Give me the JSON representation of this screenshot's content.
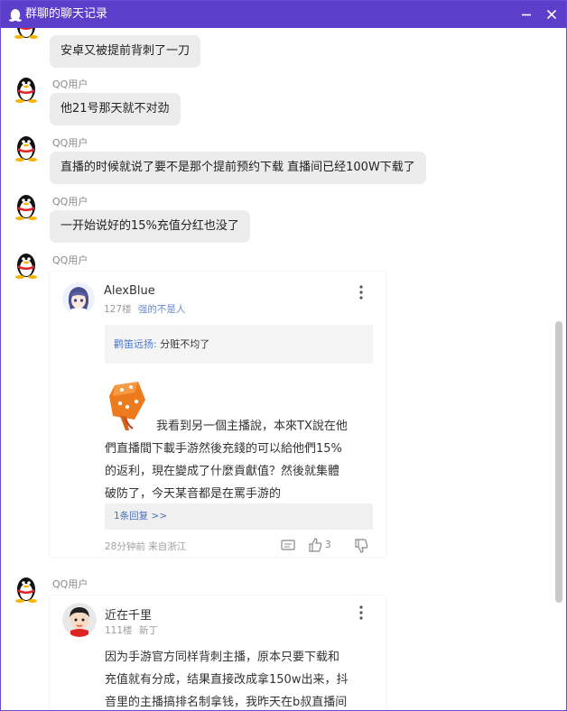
{
  "window": {
    "title": "群聊的聊天记录",
    "accent": "#5b3ec9"
  },
  "messages": [
    {
      "sender": "",
      "text": "安卓又被提前背刺了一刀"
    },
    {
      "sender": "QQ用户",
      "text": "他21号那天就不对劲"
    },
    {
      "sender": "QQ用户",
      "text": "直播的时候就说了要不是那个提前预约下载 直播间已经100W下载了"
    },
    {
      "sender": "QQ用户",
      "text": "一开始说好的15%充值分红也没了"
    },
    {
      "sender": "QQ用户"
    },
    {
      "sender": "QQ用户"
    }
  ],
  "card1": {
    "username": "AlexBlue",
    "floor": "127楼",
    "tag": "强的不是人",
    "quote_user": "鹳笛远扬:",
    "quote_text": " 分赃不均了",
    "body_line1": "我看到另一個主播說，本來TX說在他",
    "body_rest": [
      "們直播間下載手游然後充錢的可以給他們15%",
      "的返利，現在變成了什麼貢獻值？然後就集體",
      "破防了，今天某音都是在罵手游的"
    ],
    "reply_link": "1条回复 >>",
    "time_location": "28分钟前 来自浙江",
    "likes": "3"
  },
  "card2": {
    "username": "近在千里",
    "floor": "111楼",
    "tag": "新丁",
    "body_lines": [
      "因为手游官方同样背刺主播，原本只要下载和",
      "充值就有分成，结果直接改成拿150w出来，抖",
      "音里的主播搞排名制拿钱，我昨天在b叔直播间"
    ]
  }
}
